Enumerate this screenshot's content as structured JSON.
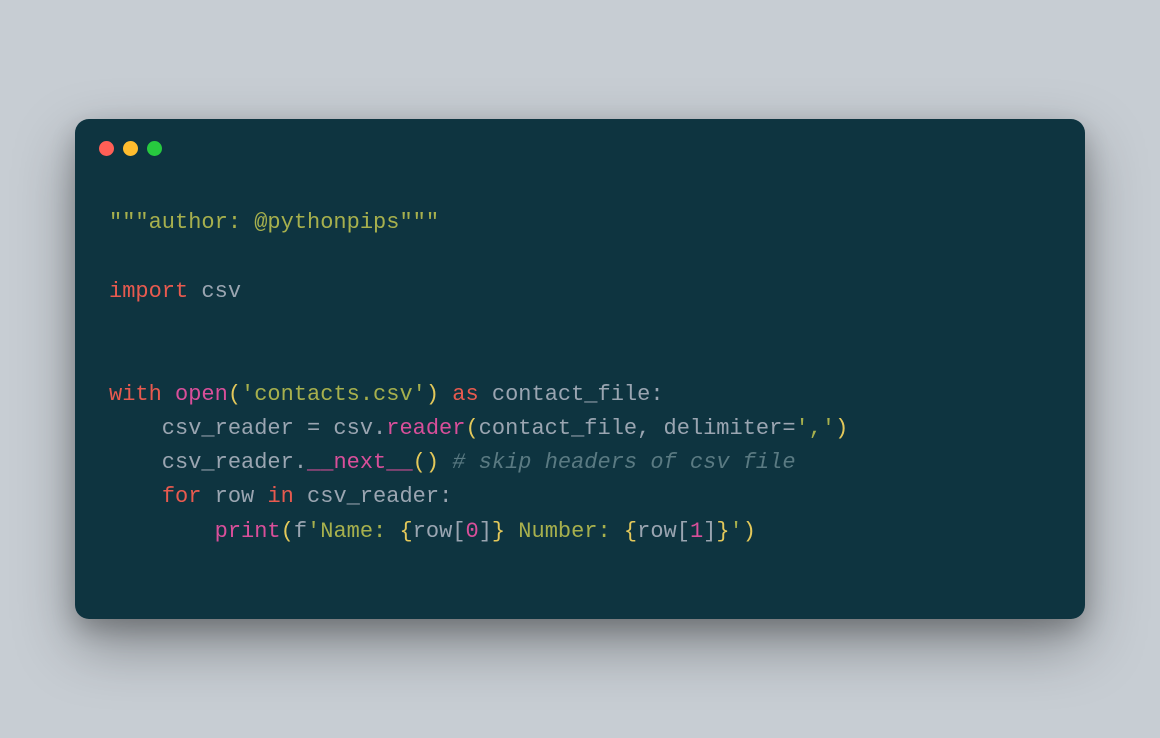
{
  "window": {
    "traffic_lights": [
      "red",
      "yellow",
      "green"
    ]
  },
  "code": {
    "lines": [
      [
        {
          "cls": "tok-str",
          "t": "\"\"\"author: @pythonpips\"\"\""
        }
      ],
      [],
      [
        {
          "cls": "tok-kw",
          "t": "import"
        },
        {
          "cls": "tok-ident",
          "t": " csv"
        }
      ],
      [],
      [],
      [
        {
          "cls": "tok-kw",
          "t": "with"
        },
        {
          "cls": "tok-ident",
          "t": " "
        },
        {
          "cls": "tok-func",
          "t": "open"
        },
        {
          "cls": "tok-paren",
          "t": "("
        },
        {
          "cls": "tok-str",
          "t": "'contacts.csv'"
        },
        {
          "cls": "tok-paren",
          "t": ")"
        },
        {
          "cls": "tok-ident",
          "t": " "
        },
        {
          "cls": "tok-kw",
          "t": "as"
        },
        {
          "cls": "tok-ident",
          "t": " contact_file:"
        }
      ],
      [
        {
          "cls": "tok-ident",
          "t": "    csv_reader = csv."
        },
        {
          "cls": "tok-func",
          "t": "reader"
        },
        {
          "cls": "tok-paren",
          "t": "("
        },
        {
          "cls": "tok-ident",
          "t": "contact_file, delimiter="
        },
        {
          "cls": "tok-str",
          "t": "','"
        },
        {
          "cls": "tok-paren",
          "t": ")"
        }
      ],
      [
        {
          "cls": "tok-ident",
          "t": "    csv_reader."
        },
        {
          "cls": "tok-func",
          "t": "__next__"
        },
        {
          "cls": "tok-paren",
          "t": "()"
        },
        {
          "cls": "tok-ident",
          "t": " "
        },
        {
          "cls": "tok-comment",
          "t": "# skip headers of csv file"
        }
      ],
      [
        {
          "cls": "tok-ident",
          "t": "    "
        },
        {
          "cls": "tok-kw",
          "t": "for"
        },
        {
          "cls": "tok-ident",
          "t": " row "
        },
        {
          "cls": "tok-kw",
          "t": "in"
        },
        {
          "cls": "tok-ident",
          "t": " csv_reader:"
        }
      ],
      [
        {
          "cls": "tok-ident",
          "t": "        "
        },
        {
          "cls": "tok-func",
          "t": "print"
        },
        {
          "cls": "tok-paren",
          "t": "("
        },
        {
          "cls": "tok-ident",
          "t": "f"
        },
        {
          "cls": "tok-str",
          "t": "'Name: "
        },
        {
          "cls": "tok-bracket",
          "t": "{"
        },
        {
          "cls": "tok-ident",
          "t": "row["
        },
        {
          "cls": "tok-num",
          "t": "0"
        },
        {
          "cls": "tok-ident",
          "t": "]"
        },
        {
          "cls": "tok-bracket",
          "t": "}"
        },
        {
          "cls": "tok-str",
          "t": " Number: "
        },
        {
          "cls": "tok-bracket",
          "t": "{"
        },
        {
          "cls": "tok-ident",
          "t": "row["
        },
        {
          "cls": "tok-num",
          "t": "1"
        },
        {
          "cls": "tok-ident",
          "t": "]"
        },
        {
          "cls": "tok-bracket",
          "t": "}"
        },
        {
          "cls": "tok-str",
          "t": "'"
        },
        {
          "cls": "tok-paren",
          "t": ")"
        }
      ]
    ]
  }
}
